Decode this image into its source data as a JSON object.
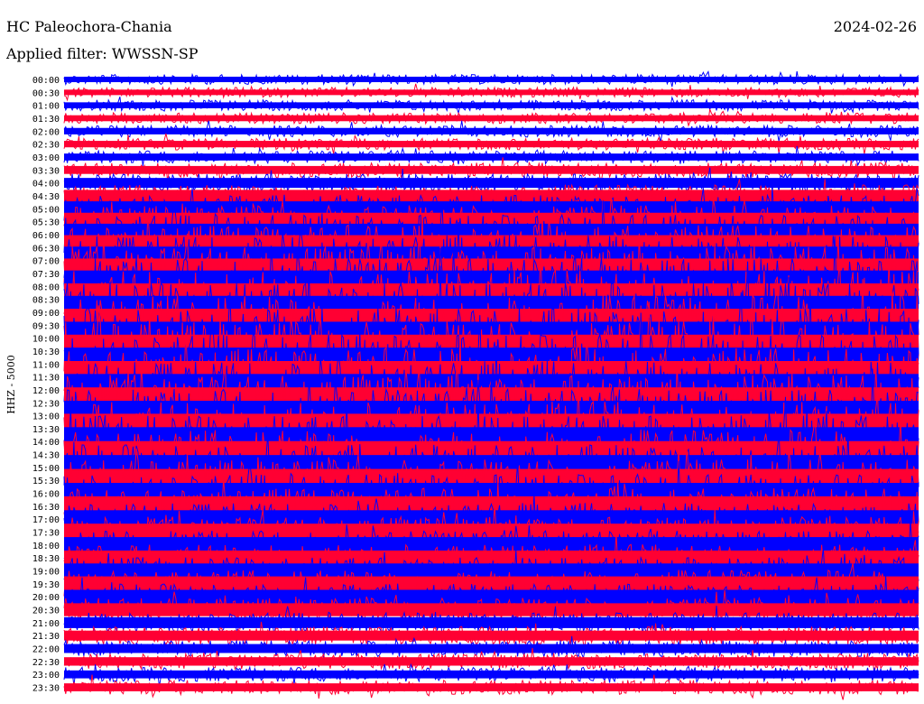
{
  "header": {
    "station": "HC Paleochora-Chania",
    "date": "2024-02-26",
    "filter": "Applied filter: WWSSN-SP"
  },
  "chart_data": {
    "type": "line",
    "title": "HC Paleochora-Chania",
    "subtitle": "Applied filter: WWSSN-SP",
    "ylabel": "HHZ - 5000",
    "xlabel": "",
    "y_tick_labels": [
      "00:00",
      "00:30",
      "01:00",
      "01:30",
      "02:00",
      "02:30",
      "03:00",
      "03:30",
      "04:00",
      "04:30",
      "05:00",
      "05:30",
      "06:00",
      "06:30",
      "07:00",
      "07:30",
      "08:00",
      "08:30",
      "09:00",
      "09:30",
      "10:00",
      "10:30",
      "11:00",
      "11:30",
      "12:00",
      "12:30",
      "13:00",
      "13:30",
      "14:00",
      "14:30",
      "15:00",
      "15:30",
      "16:00",
      "16:30",
      "17:00",
      "17:30",
      "18:00",
      "18:30",
      "19:00",
      "19:30",
      "20:00",
      "20:30",
      "21:00",
      "21:30",
      "22:00",
      "22:30",
      "23:00",
      "23:30"
    ],
    "series_colors": [
      "#0000ff",
      "#ff0033"
    ],
    "amplitude_profile": [
      0.55,
      0.55,
      0.6,
      0.6,
      0.65,
      0.65,
      0.7,
      0.8,
      1.0,
      1.2,
      1.5,
      1.8,
      2.2,
      2.5,
      2.8,
      3.0,
      3.2,
      3.2,
      3.3,
      3.3,
      3.3,
      3.3,
      3.3,
      3.2,
      3.2,
      3.1,
      3.0,
      3.0,
      2.9,
      2.7,
      2.5,
      2.3,
      2.1,
      2.0,
      1.8,
      1.7,
      1.6,
      1.5,
      1.5,
      1.5,
      1.4,
      1.3,
      1.1,
      1.0,
      0.9,
      0.85,
      0.8,
      0.8
    ],
    "grid": false,
    "legend": "none"
  }
}
